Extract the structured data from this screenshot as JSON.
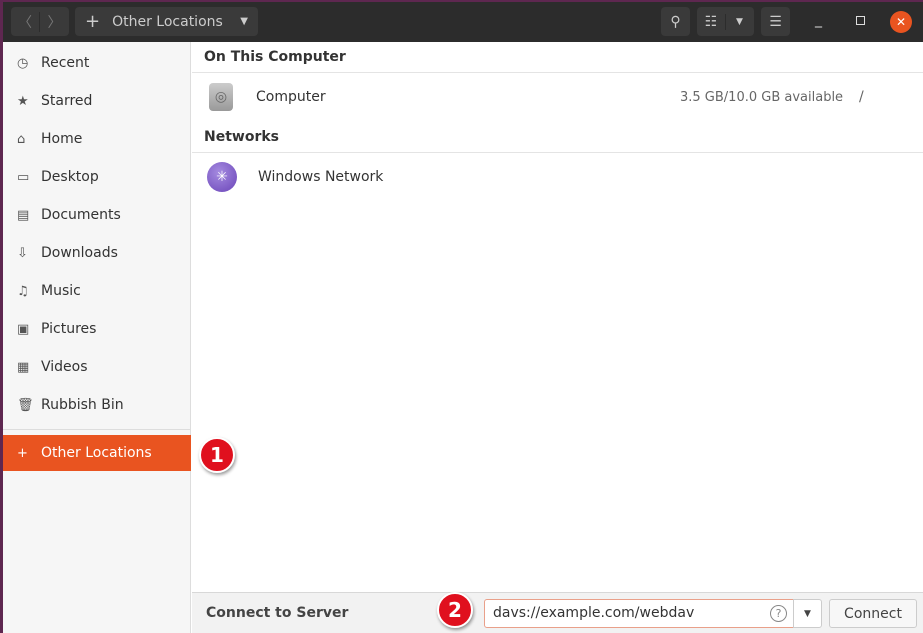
{
  "titlebar": {
    "location": "Other Locations"
  },
  "sidebar": {
    "items": [
      {
        "label": "Recent",
        "icon": "clock-icon"
      },
      {
        "label": "Starred",
        "icon": "star-icon"
      },
      {
        "label": "Home",
        "icon": "home-icon"
      },
      {
        "label": "Desktop",
        "icon": "desktop-icon"
      },
      {
        "label": "Documents",
        "icon": "document-icon"
      },
      {
        "label": "Downloads",
        "icon": "download-icon"
      },
      {
        "label": "Music",
        "icon": "music-icon"
      },
      {
        "label": "Pictures",
        "icon": "picture-icon"
      },
      {
        "label": "Videos",
        "icon": "video-icon"
      },
      {
        "label": "Rubbish Bin",
        "icon": "trash-icon"
      }
    ],
    "other": {
      "label": "Other Locations",
      "icon": "plus-icon"
    }
  },
  "main": {
    "on_this_computer": "On This Computer",
    "computer": {
      "name": "Computer",
      "space": "3.5 GB/10.0 GB available",
      "mount": "/"
    },
    "networks": "Networks",
    "windows_network": "Windows Network"
  },
  "bottom": {
    "label": "Connect to Server",
    "server_value": "davs://example.com/webdav",
    "connect": "Connect"
  },
  "annotations": [
    "1",
    "2"
  ],
  "colors": {
    "accent": "#e95420",
    "badge": "#e0101e"
  }
}
